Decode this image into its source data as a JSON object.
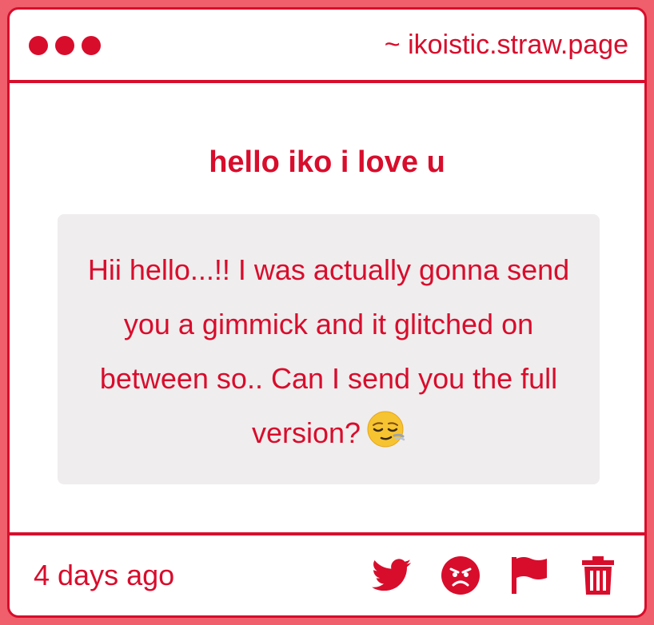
{
  "header": {
    "url": "~ ikoistic.straw.page"
  },
  "post": {
    "title": "hello iko i love u",
    "message": "Hii hello...!! I was actually gonna send you a gimmick and it glitched on between so.. Can I send you the full version?",
    "emoji": "relieved-face-emoji"
  },
  "footer": {
    "time": "4 days ago",
    "icons": [
      "twitter-icon",
      "angry-face-icon",
      "flag-icon",
      "trash-icon"
    ]
  },
  "colors": {
    "accent": "#d80d2c",
    "frame": "#ef5f6c",
    "message_bg": "#efedee"
  }
}
